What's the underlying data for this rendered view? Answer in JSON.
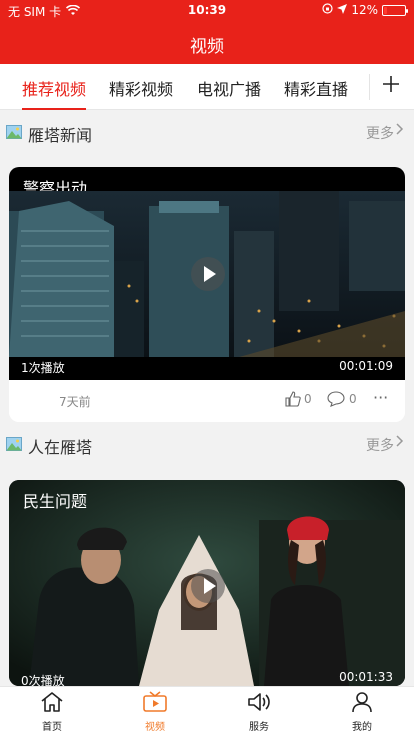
{
  "status_bar": {
    "carrier": "无 SIM 卡",
    "time": "10:39",
    "battery": "12%",
    "battery_level": 0.12
  },
  "header": {
    "title": "视频"
  },
  "tabs": [
    {
      "label": "推荐视频",
      "active": true
    },
    {
      "label": "精彩视频",
      "active": false
    },
    {
      "label": "电视广播",
      "active": false
    },
    {
      "label": "精彩直播",
      "active": false
    }
  ],
  "tab_add_icon": "plus-icon",
  "sections": [
    {
      "title": "雁塔新闻",
      "more_label": "更多",
      "card": {
        "title": "警察出动",
        "plays": "1次播放",
        "duration": "00:01:09",
        "age": "7天前",
        "likes": "0",
        "comments": "0"
      }
    },
    {
      "title": "人在雁塔",
      "more_label": "更多",
      "card": {
        "title": "民生问题",
        "plays": "0次播放",
        "duration": "00:01:33"
      }
    }
  ],
  "bottom_nav": [
    {
      "label": "首页",
      "icon": "home-icon",
      "active": false
    },
    {
      "label": "视频",
      "icon": "tv-icon",
      "active": true
    },
    {
      "label": "服务",
      "icon": "speaker-icon",
      "active": false
    },
    {
      "label": "我的",
      "icon": "person-icon",
      "active": false
    }
  ],
  "colors": {
    "brand_red": "#e8221a",
    "active_nav": "#f07a2a"
  }
}
